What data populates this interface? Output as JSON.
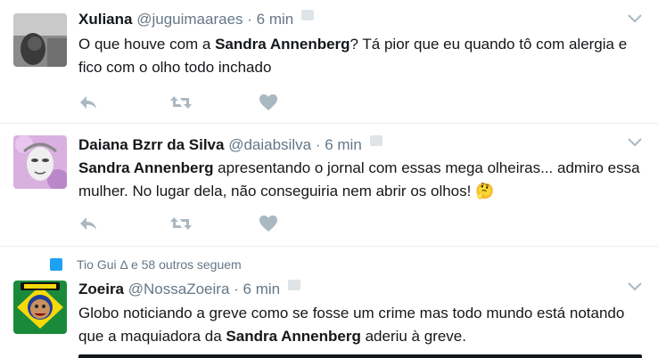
{
  "tweets": [
    {
      "name": "Xuliana",
      "handle": "@juguimaaraes",
      "time": "6 min",
      "text_before": "O que houve com a ",
      "text_bold": "Sandra Annenberg",
      "text_after": "? Tá pior que eu quando tô com alergia e fico com o olho todo inchado",
      "avatar_icon": "avatar-photo-icon"
    },
    {
      "name": "Daiana Bzrr da Silva",
      "handle": "@daiabsilva",
      "time": "6 min",
      "text_before": "",
      "text_bold": "Sandra Annenberg",
      "text_after": " apresentando o jornal com essas mega olheiras... admiro essa mulher. No lugar dela, não conseguiria nem abrir os olhos! ",
      "emoji": "🤔",
      "avatar_icon": "avatar-art-icon"
    },
    {
      "social_context": "Tio Gui Δ e 58 outros seguem",
      "name": "Zoeira",
      "handle": "@NossaZoeira",
      "time": "6 min",
      "text_before": "Globo noticiando a greve como se fosse um crime mas todo mundo está notando que a maquiadora da ",
      "text_bold": "Sandra Annenberg",
      "text_after": " aderiu à greve.",
      "avatar_icon": "avatar-logo-icon"
    }
  ],
  "sep": "·",
  "colors": {
    "name": "#14171a",
    "meta": "#657786",
    "icon": "#aab8c2",
    "accent": "#1da1f2"
  }
}
